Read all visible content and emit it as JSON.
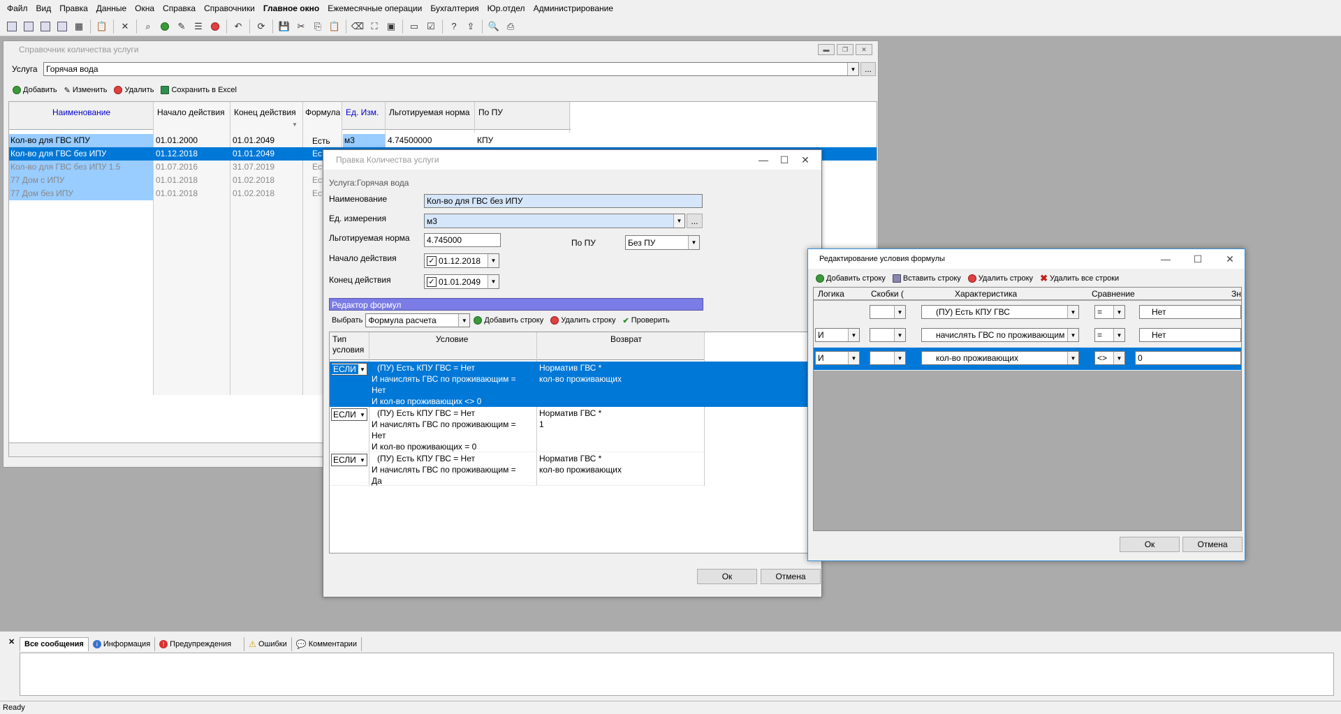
{
  "menu": [
    "Файл",
    "Вид",
    "Правка",
    "Данные",
    "Окна",
    "Справка",
    "Справочники",
    "Главное окно",
    "Ежемесячные операции",
    "Бухгалтерия",
    "Юр.отдел",
    "Администрирование"
  ],
  "main_window": {
    "title": "Справочник количества услуги",
    "service_label": "Услуга",
    "service_value": "Горячая вода",
    "browse": "...",
    "toolbar": {
      "add": "Добавить",
      "edit": "Изменить",
      "delete": "Удалить",
      "excel": "Сохранить в Excel"
    },
    "columns": [
      "Наименование",
      "Начало действия",
      "Конец действия",
      "Формула",
      "Ед. Изм.",
      "Льготируемая норма",
      "По ПУ"
    ],
    "rows": [
      {
        "name": "Кол-во для ГВС КПУ",
        "start": "01.01.2000",
        "end": "01.01.2049",
        "formula": "Есть",
        "unit": "м3",
        "norm": "4.74500000",
        "pu": "КПУ"
      },
      {
        "name": "Кол-во для ГВС без ИПУ",
        "start": "01.12.2018",
        "end": "01.01.2049",
        "formula": "Ест",
        "unit": "",
        "norm": "",
        "pu": ""
      },
      {
        "name": "Кол-во для ГВС без ИПУ 1.5",
        "start": "01.07.2016",
        "end": "31.07.2019",
        "formula": "Ест",
        "unit": "",
        "norm": "",
        "pu": ""
      },
      {
        "name": "77 Дом с ИПУ",
        "start": "01.01.2018",
        "end": "01.02.2018",
        "formula": "Ест",
        "unit": "",
        "norm": "",
        "pu": ""
      },
      {
        "name": "77 Дом без ИПУ",
        "start": "01.01.2018",
        "end": "01.02.2018",
        "formula": "Ест",
        "unit": "",
        "norm": "",
        "pu": ""
      }
    ]
  },
  "edit_window": {
    "title": "Правка Количества услуги",
    "service_caption": "Услуга:Горячая вода",
    "name_label": "Наименование",
    "name_value": "Кол-во для ГВС без ИПУ",
    "unit_label": "Ед. измерения",
    "unit_value": "м3",
    "norm_label": "Льготируемая норма",
    "norm_value": "4.745000",
    "pu_label": "По ПУ",
    "pu_value": "Без ПУ",
    "start_label": "Начало действия",
    "start_value": "01.12.2018",
    "end_label": "Конец действия",
    "end_value": "01.01.2049",
    "formula_editor": "Редактор формул",
    "choose_label": "Выбрать",
    "choose_value": "Формула расчета",
    "add_row": "Добавить строку",
    "delete_row": "Удалить строку",
    "check": "Проверить",
    "col_type": "Тип условия",
    "col_condition": "Условие",
    "col_return": "Возврат",
    "formula_rows": [
      {
        "type": "ЕСЛИ",
        "condition": [
          "(ПУ) Есть КПУ ГВС = Нет",
          "И  начислять ГВС по проживающим =",
          "Нет",
          "И  кол-во проживающих <> 0"
        ],
        "ret": [
          "Норматив ГВС *",
          "кол-во проживающих"
        ]
      },
      {
        "type": "ЕСЛИ",
        "condition": [
          "(ПУ) Есть КПУ ГВС = Нет",
          "И  начислять ГВС по проживающим =",
          "Нет",
          "И  кол-во проживающих = 0"
        ],
        "ret": [
          "Норматив ГВС *",
          "1"
        ]
      },
      {
        "type": "ЕСЛИ",
        "condition": [
          "(ПУ) Есть КПУ ГВС = Нет",
          "И  начислять ГВС по проживающим =",
          "Да"
        ],
        "ret": [
          "Норматив ГВС *",
          "кол-во проживающих"
        ]
      }
    ],
    "ok": "Ок",
    "cancel": "Отмена"
  },
  "cond_window": {
    "title": "Редактирование условия формулы",
    "add_row": "Добавить строку",
    "insert_row": "Вставить строку",
    "delete_row": "Удалить строку",
    "delete_all": "Удалить все строки",
    "columns": [
      "Логика",
      "Скобки (",
      "Характеристика",
      "Сравнение",
      "Зн"
    ],
    "rows": [
      {
        "logic": "",
        "bracket": "",
        "char": "(ПУ) Есть КПУ ГВС",
        "cmp": "=",
        "val": "Нет"
      },
      {
        "logic": "И",
        "bracket": "",
        "char": "начислять ГВС по проживающим",
        "cmp": "=",
        "val": "Нет"
      },
      {
        "logic": "И",
        "bracket": "",
        "char": "кол-во проживающих",
        "cmp": "<>",
        "val": "0"
      }
    ],
    "ok": "Ок",
    "cancel": "Отмена"
  },
  "messages": {
    "tabs": [
      "Все сообщения",
      "Информация",
      "Предупреждения",
      "Ошибки",
      "Комментарии"
    ]
  },
  "status": "Ready"
}
